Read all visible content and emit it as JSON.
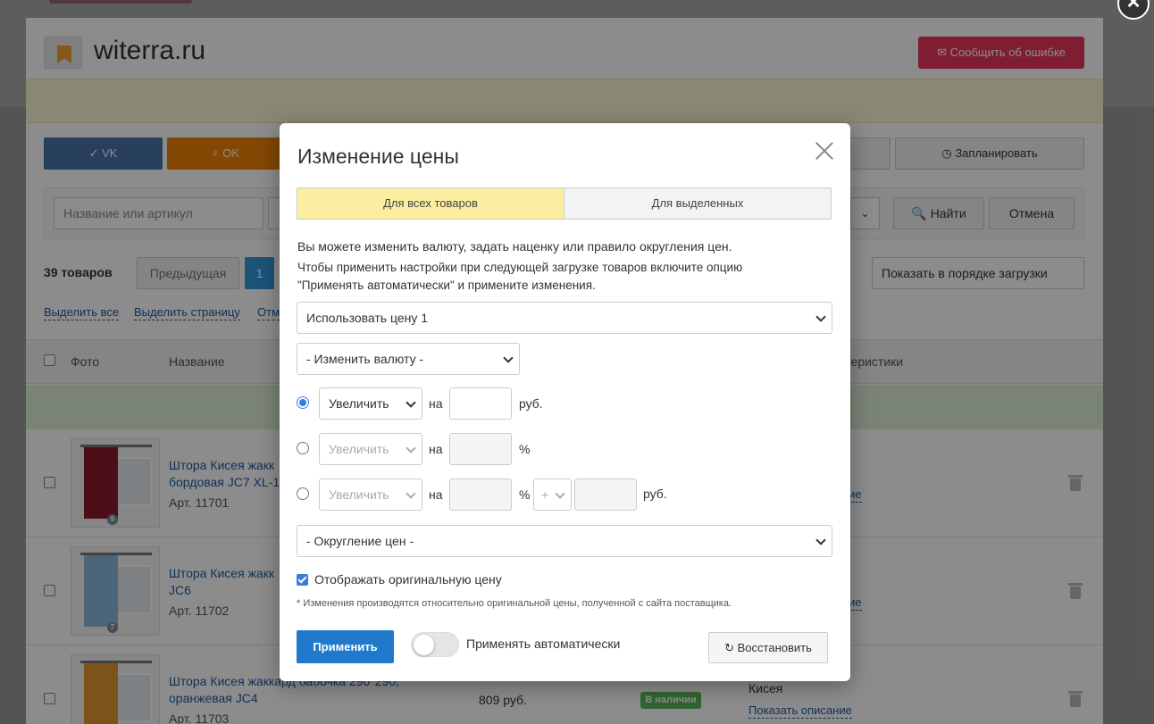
{
  "site": {
    "title": "witerra.ru",
    "report_label": "✉ Сообщить об ошибке"
  },
  "toolbar": {
    "vk_label": "VK",
    "ok_label": "OK",
    "plan_label": "◷ Запланировать"
  },
  "filter": {
    "search_placeholder": "Название или артикул",
    "find_label": "Найти",
    "cancel_label": "Отмена"
  },
  "list": {
    "count": "39 товаров",
    "prev_label": "Предыдущая",
    "page": "1",
    "order_label": "Показать в порядке загрузки",
    "select_all": "Выделить все",
    "select_page": "Выделить страницу",
    "other_link": "Отм"
  },
  "table": {
    "col_photo": "Фото",
    "col_name": "Название",
    "col_chars": "ктеристики",
    "rows": [
      {
        "name1": "Штора Кисея жакк",
        "name2": "бордовая JC7 XL-1",
        "art": "Арт. 11701",
        "badge": "9",
        "desc": "ие",
        "color": "#8b1a2e"
      },
      {
        "name1": "Штора Кисея жакк",
        "name2": "JC6",
        "art": "Арт. 11702",
        "badge": "7",
        "desc": "ие",
        "color": "#8ab8dc"
      },
      {
        "name1": "Штора Кисея жаккард бабочка 290*290,",
        "name2": "оранжевая JC4",
        "art": "Арт. 11703",
        "price": "809 руб.",
        "stock": "В наличии",
        "material": "Кисея",
        "desc": "Показать описание",
        "color": "#e29a2e"
      }
    ]
  },
  "modal": {
    "title": "Изменение цены",
    "tab_all": "Для всех товаров",
    "tab_selected": "Для выделенных",
    "info1": "Вы можете изменить валюту, задать наценку или правило округления цен.",
    "info2": "Чтобы применить настройки при следующей загрузке товаров включите опцию",
    "info3": "\"Применять автоматически\" и примените изменения.",
    "price_select": "Использовать цену 1",
    "currency_select": "- Изменить валюту -",
    "rule1": {
      "op": "Увеличить",
      "on": "на",
      "unit": "руб."
    },
    "rule2": {
      "op": "Увеличить",
      "on": "на",
      "unit": "%"
    },
    "rule3": {
      "op": "Увеличить",
      "on": "на",
      "unit1": "%",
      "sign": "+",
      "unit2": "руб."
    },
    "rounding_select": "- Округление цен -",
    "show_original": "Отображать оригинальную цену",
    "note": "* Изменения производятся относительно оригинальной цены, полученной с сайта поставщика.",
    "apply_label": "Применить",
    "auto_label": "Применять автоматически",
    "restore_label": "↻ Восстановить"
  }
}
